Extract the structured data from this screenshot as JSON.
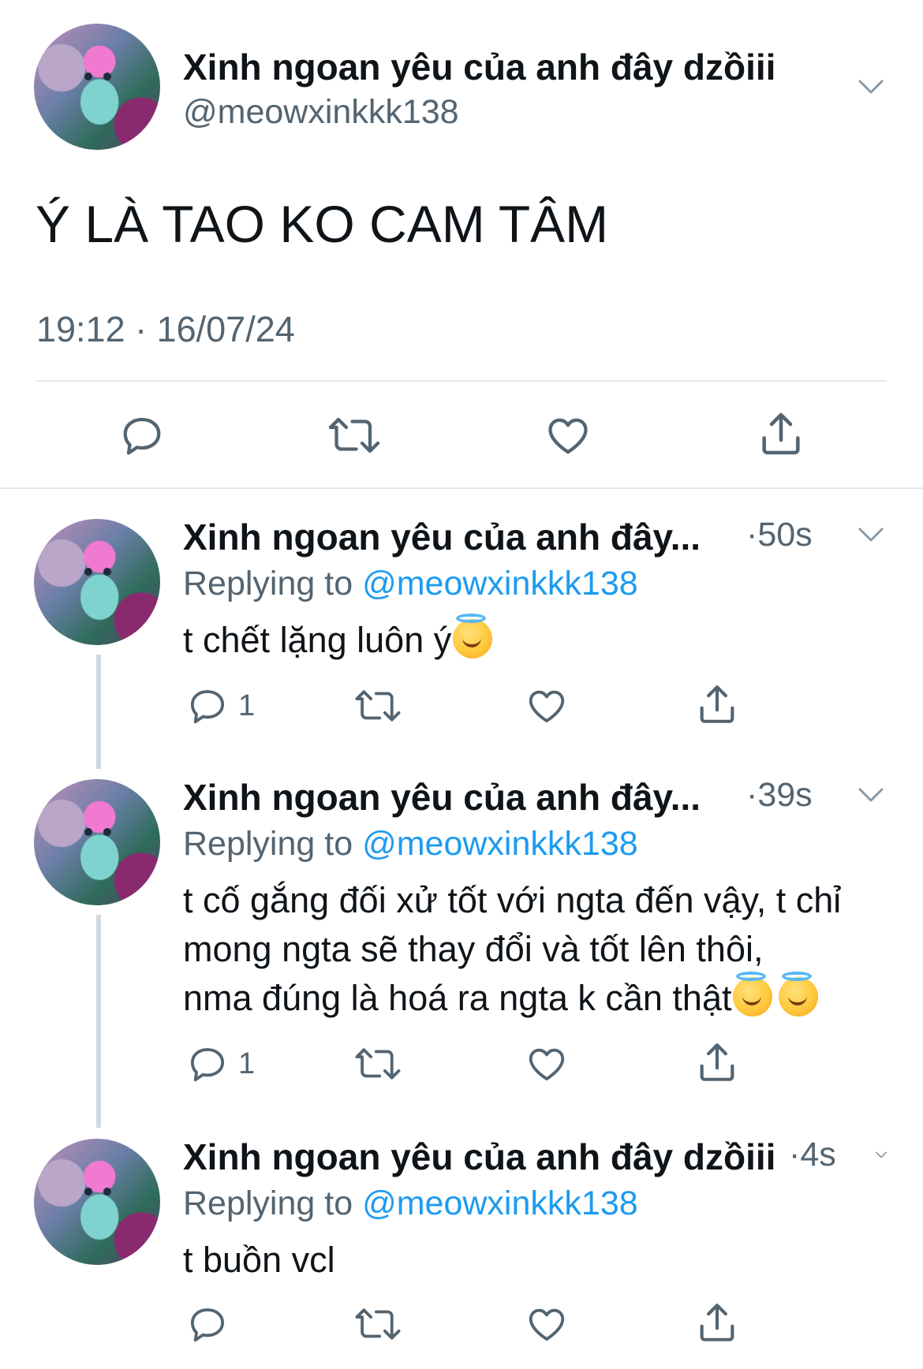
{
  "main_tweet": {
    "display_name": "Xinh ngoan yêu của anh đây dzồiii",
    "handle": "@meowxinkkk138",
    "text": "Ý LÀ TAO KO CAM TÂM",
    "timestamp": "19:12 · 16/07/24"
  },
  "replies": [
    {
      "display_name": "Xinh ngoan yêu của anh đây...",
      "time": "·50s",
      "replying_prefix": "Replying to ",
      "replying_handle": "@meowxinkkk138",
      "text": "t chết lặng luôn ý",
      "reply_count": "1"
    },
    {
      "display_name": "Xinh ngoan yêu của anh đây...",
      "time": "·39s",
      "replying_prefix": "Replying to ",
      "replying_handle": "@meowxinkkk138",
      "text_line1": "t cố gắng đối xử tốt với ngta đến vậy, t chỉ",
      "text_line2": "mong ngta sẽ thay đổi và tốt lên thôi,",
      "text_line3": "nma đúng là hoá ra ngta k cần thật",
      "reply_count": "1"
    },
    {
      "display_name": "Xinh ngoan yêu của anh đây dzồiii",
      "time": "·4s",
      "replying_prefix": "Replying to ",
      "replying_handle": "@meowxinkkk138",
      "text": "t buồn vcl",
      "reply_count": ""
    }
  ],
  "icons": [
    "reply-icon",
    "retweet-icon",
    "like-icon",
    "share-icon",
    "chevron-down-icon"
  ],
  "colors": {
    "text": "#0f1419",
    "secondary": "#536471",
    "link": "#1d9bf0",
    "divider": "#e1e8ed"
  }
}
